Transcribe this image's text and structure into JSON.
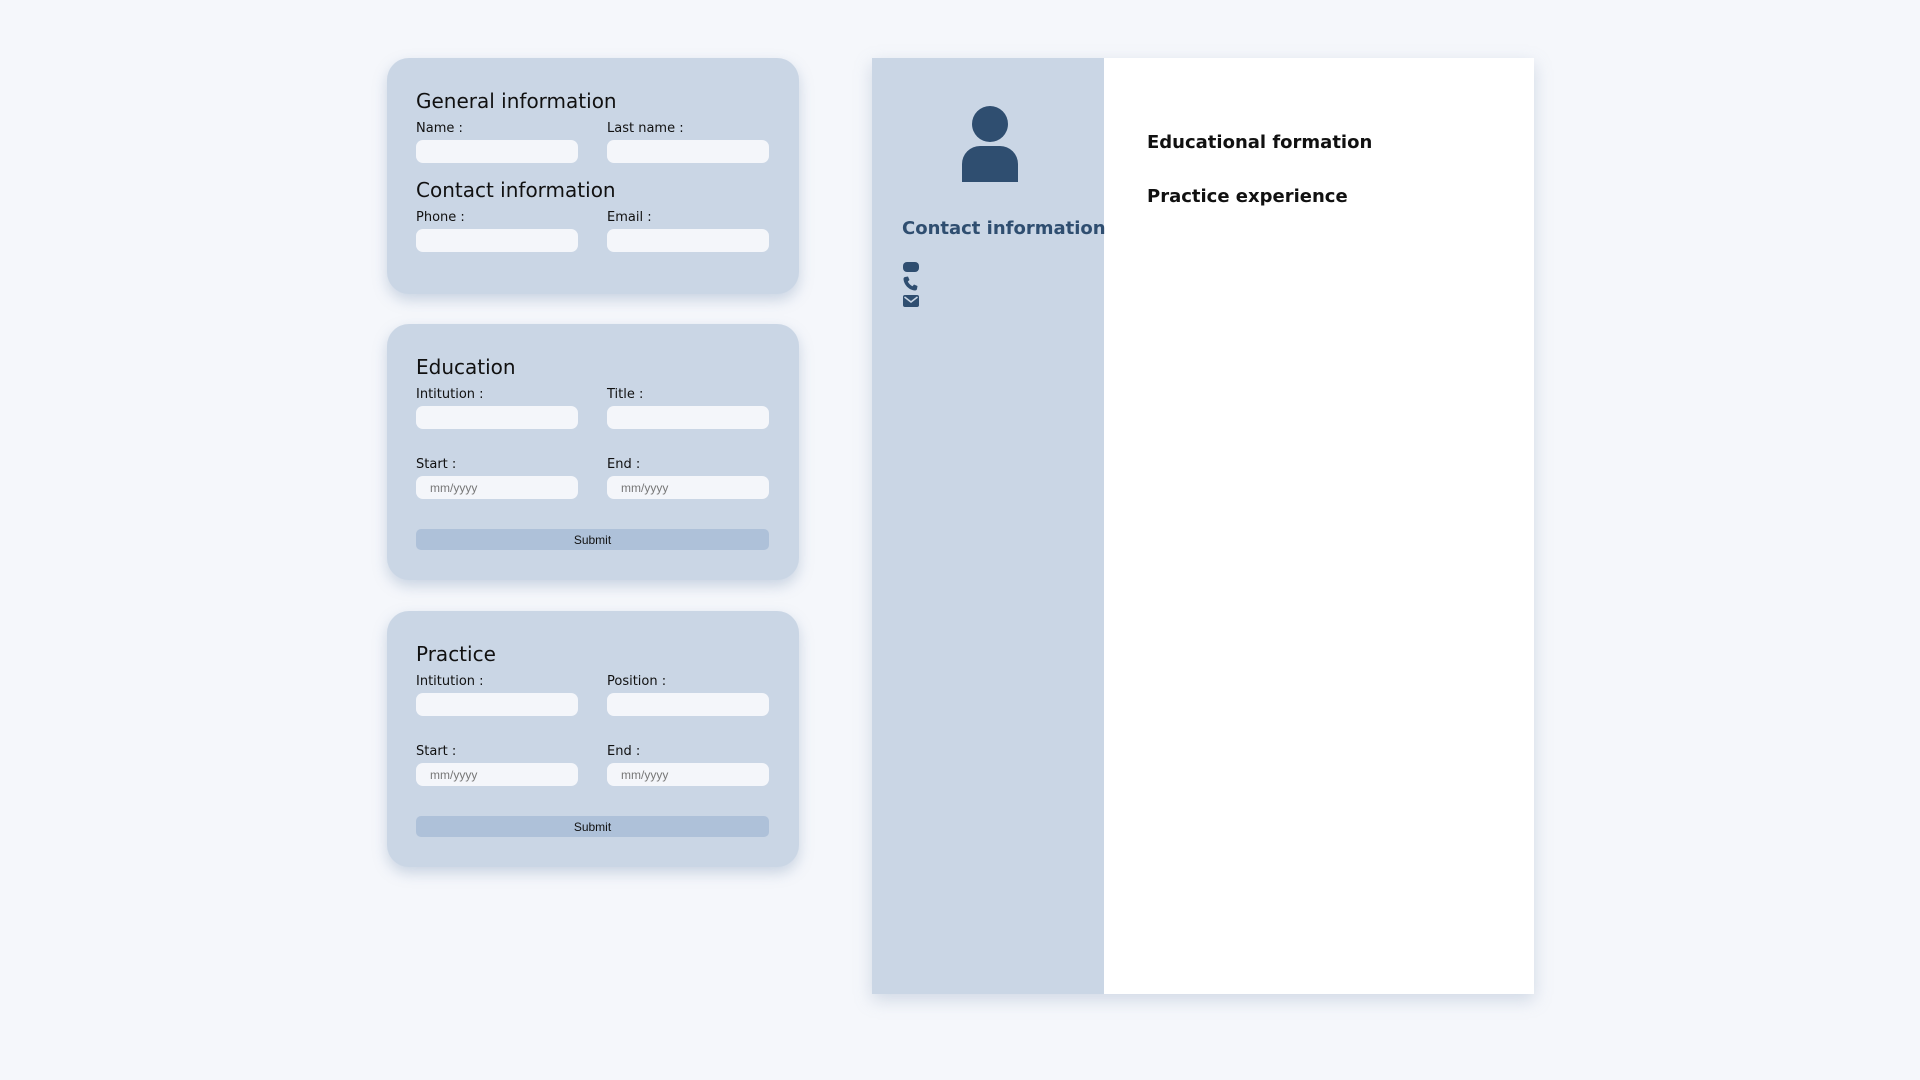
{
  "general": {
    "title": "General information",
    "name_label": "Name :",
    "lastname_label": "Last name :",
    "name_value": "",
    "lastname_value": ""
  },
  "contact": {
    "title": "Contact information",
    "phone_label": "Phone :",
    "email_label": "Email :",
    "phone_value": "",
    "email_value": ""
  },
  "education": {
    "title": "Education",
    "institution_label": "Intitution :",
    "title_label": "Title :",
    "start_label": "Start :",
    "end_label": "End :",
    "date_placeholder": "mm/yyyy",
    "submit_label": "Submit"
  },
  "practice": {
    "title": "Practice",
    "institution_label": "Intitution :",
    "position_label": "Position :",
    "start_label": "Start :",
    "end_label": "End :",
    "date_placeholder": "mm/yyyy",
    "submit_label": "Submit"
  },
  "cv": {
    "contact_title": "Contact information",
    "contact_items": [
      {
        "icon": "id-card-icon",
        "value": ""
      },
      {
        "icon": "phone-icon",
        "value": ""
      },
      {
        "icon": "envelope-icon",
        "value": ""
      }
    ],
    "educational_heading": "Educational formation",
    "practice_heading": "Practice experience"
  },
  "colors": {
    "background": "#f5f7fb",
    "card": "#cad6e5",
    "input": "#f4f6fa",
    "submit": "#aec1d9",
    "accent": "#2f4e70"
  }
}
